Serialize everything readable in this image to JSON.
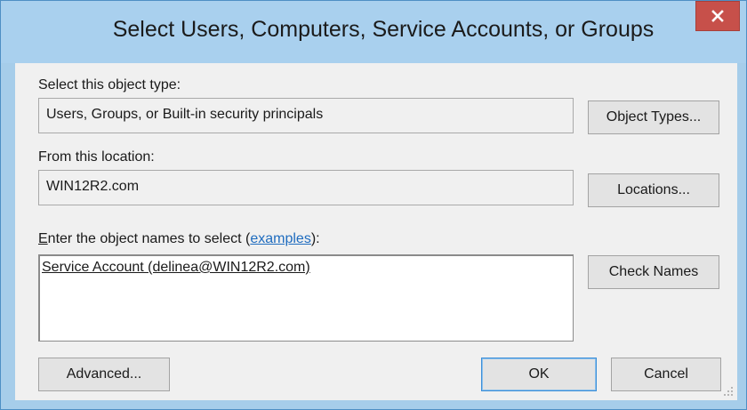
{
  "dialog": {
    "title": "Select Users, Computers, Service Accounts, or Groups",
    "close_label": "x"
  },
  "object_type": {
    "label": "Select this object type:",
    "value": "Users, Groups, or Built-in security principals",
    "button_label": "Object Types..."
  },
  "location": {
    "label": "From this location:",
    "value": "WIN12R2.com",
    "button_label": "Locations..."
  },
  "object_names": {
    "label_mnemonic": "E",
    "label_before_link": "nter the object names to select (",
    "link_text": "examples",
    "label_after_link": "):",
    "entry": "Service Account (delinea@WIN12R2.com)",
    "check_button_label": "Check Names"
  },
  "footer": {
    "advanced_label": "Advanced...",
    "ok_label": "OK",
    "cancel_label": "Cancel"
  },
  "colors": {
    "title_bar": "#a9d0ee",
    "close_button": "#c7504a",
    "link": "#1f6cbf",
    "default_button_border": "#3c8fd8"
  }
}
